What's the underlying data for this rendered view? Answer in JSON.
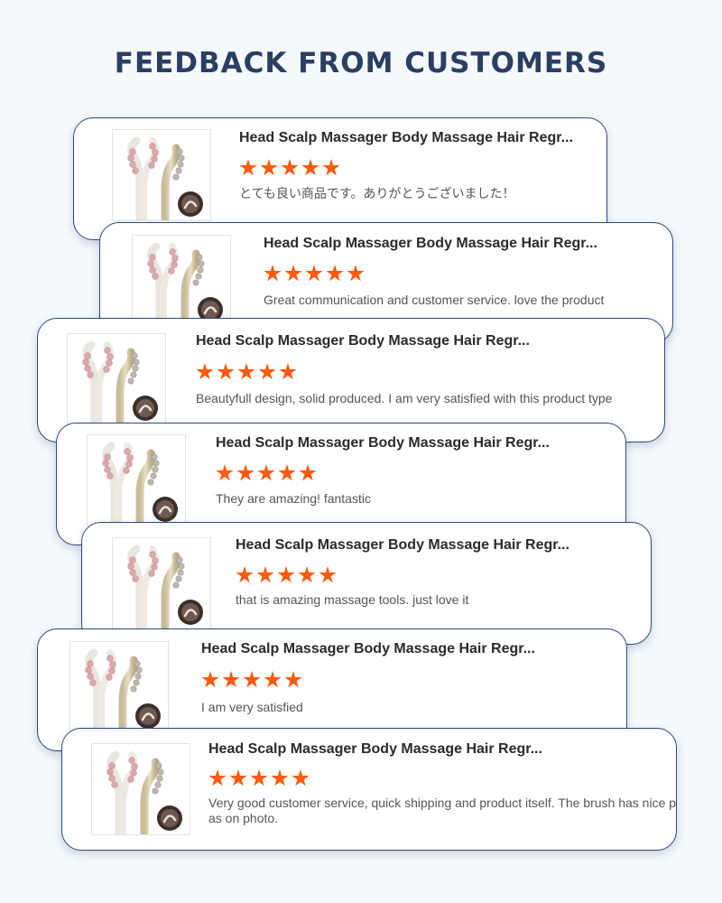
{
  "header": {
    "title": "FEEDBACK FROM CUSTOMERS"
  },
  "colors": {
    "title": "#2a3f63",
    "card_border": "#2d4a7a",
    "star": "#ff5a0f",
    "background": "#f5f8fc"
  },
  "product_image_icon": "scalp-massager-product-image",
  "reviews": [
    {
      "product": "Head Scalp Massager Body Massage Hair Regr...",
      "rating": 5,
      "comment": "とても良い商品です。ありがとうございました！"
    },
    {
      "product": "Head Scalp Massager Body Massage Hair Regr...",
      "rating": 5,
      "comment": "Great communication and customer service. love the product"
    },
    {
      "product": "Head Scalp Massager Body Massage Hair Regr...",
      "rating": 5,
      "comment": "Beautyfull design, solid produced. I am very satisfied with this product type"
    },
    {
      "product": "Head Scalp Massager Body Massage Hair Regr...",
      "rating": 5,
      "comment": "They are amazing! fantastic"
    },
    {
      "product": "Head Scalp Massager Body Massage Hair Regr...",
      "rating": 5,
      "comment": "that is amazing massage tools. just love it"
    },
    {
      "product": "Head Scalp Massager Body Massage Hair Regr...",
      "rating": 5,
      "comment": "I am very satisfied"
    },
    {
      "product": "Head Scalp Massager Body Massage Hair Regr...",
      "rating": 5,
      "comment": "Very good customer service, quick shipping and product itself. The brush has nice pa me as on photo."
    }
  ]
}
